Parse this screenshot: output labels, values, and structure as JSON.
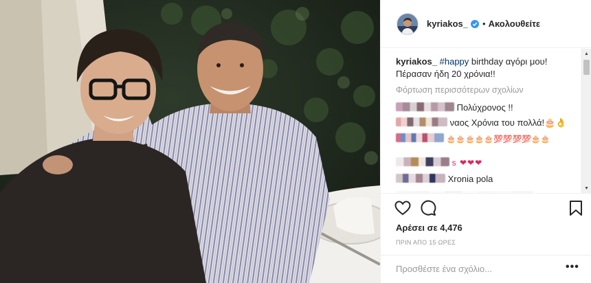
{
  "post": {
    "username": "kyriakos_",
    "dot": "•",
    "follow_label": "Ακολουθείτε",
    "caption": {
      "username": "kyriakos_",
      "hashtag": "#happy",
      "text": " birthday αγόρι μου! Πέρασαν ήδη 20 χρόνια!!"
    },
    "load_more": "Φόρτωση περισσότερων σχολίων",
    "comments": [
      {
        "text": "Πολύχρονος !!"
      },
      {
        "text": "ναος Χρόνια του πολλά!🎂👌"
      },
      {
        "text": "🎂🎂🎂🎂🎂💯💯💯💯🎂🎂"
      },
      {
        "text": "s ❤❤❤"
      },
      {
        "text": "Xronia pola"
      }
    ],
    "likes": "Αρέσει σε 4,476",
    "time": "ΠΡΙΝ ΑΠΟ 15 ΩΡΕΣ",
    "comment_placeholder": "Προσθέστε ένα σχόλιο...",
    "more_options": "•••"
  },
  "icons": {
    "like": "heart-icon",
    "comment": "comment-icon",
    "save": "bookmark-icon",
    "verified": "verified-badge-icon",
    "more": "more-options-icon"
  },
  "colors": {
    "text": "#262626",
    "muted": "#999999",
    "hashtag": "#003569",
    "verified": "#3897f0",
    "border": "#efefef"
  }
}
